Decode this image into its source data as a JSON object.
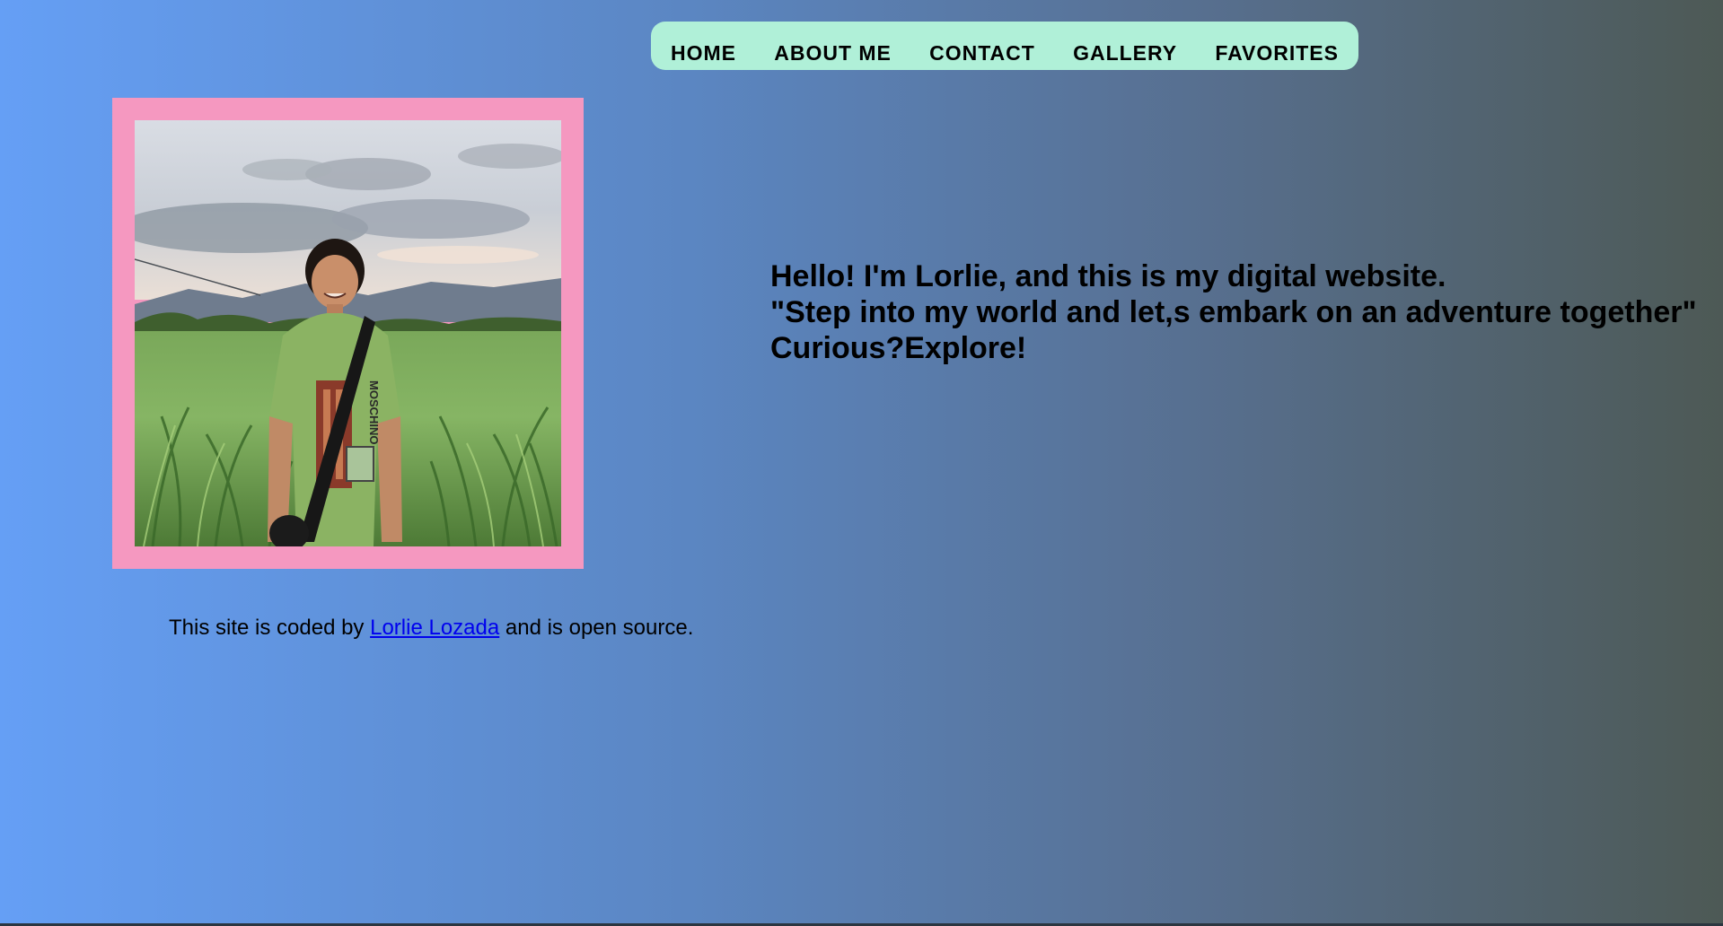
{
  "nav": {
    "items": [
      {
        "label": "HOME"
      },
      {
        "label": "ABOUT ME"
      },
      {
        "label": "CONTACT"
      },
      {
        "label": "GALLERY"
      },
      {
        "label": "FAVORITES"
      }
    ]
  },
  "intro": {
    "line1": "Hello! I'm Lorlie, and this is my digital website.",
    "line2": "\"Step into my world and let,s embark on an adventure together\"",
    "line3": "Curious?Explore!"
  },
  "photo": {
    "shirt_text": "MOSCHINO"
  },
  "footer": {
    "text_before": "This site is coded by ",
    "author_link": "Lorlie Lozada",
    "text_after": " and is open source."
  },
  "colors": {
    "nav_background": "#b0f0d8",
    "frame_pink": "#f598c0",
    "link_blue": "#0000ee",
    "gradient_start": "#659ff5",
    "gradient_end": "#4d5955"
  }
}
